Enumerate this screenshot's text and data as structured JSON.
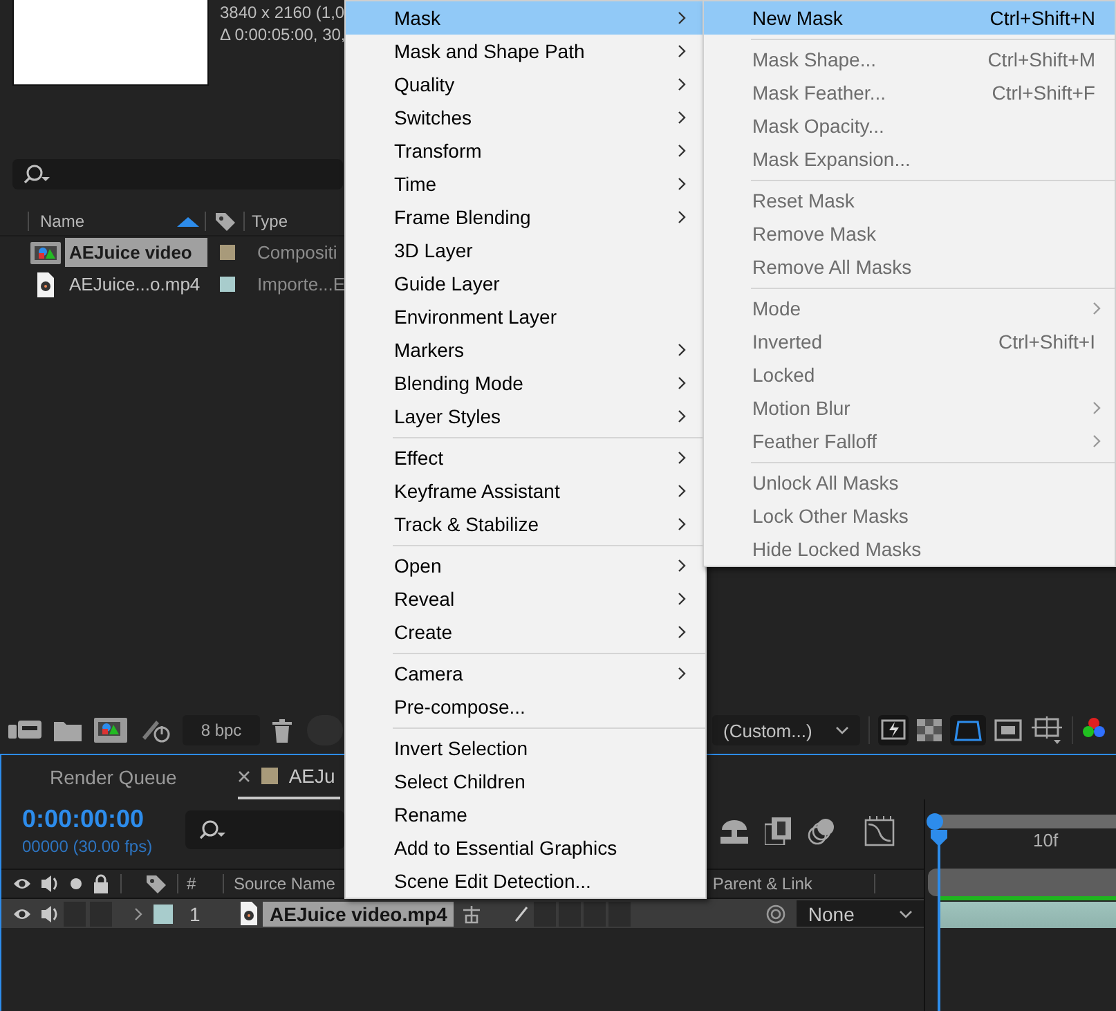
{
  "project": {
    "comp_info": [
      "3840 x 2160 (1,0",
      "Δ 0:00:05:00, 30,"
    ],
    "columns": [
      {
        "label": "Name",
        "sorted": true
      },
      {
        "label": "Type",
        "sorted": false
      }
    ],
    "items": [
      {
        "name": "AEJuice video",
        "kind": "composition",
        "color": "#a89a7a",
        "type": "Compositi",
        "selected": true
      },
      {
        "name": "AEJuice...o.mp4",
        "kind": "footage",
        "color": "#a8cccc",
        "type": "Importe...E",
        "selected": false
      }
    ]
  },
  "toolbar": {
    "bit_depth": "8 bpc",
    "view": "(Custom...)"
  },
  "timeline": {
    "tabs": [
      {
        "label": "Render Queue",
        "selected": false,
        "closable": false
      },
      {
        "label": "AEJu",
        "selected": true,
        "closable": true,
        "color": "#a89a7a"
      }
    ],
    "timecode": "0:00:00:00",
    "frame_info": "00000 (30.00 fps)",
    "columns": {
      "number": "#",
      "source_name": "Source Name",
      "parent": "Parent & Link"
    },
    "ruler": [
      "10f"
    ],
    "layers": [
      {
        "number": "1",
        "name": "AEJuice video.mp4",
        "color": "#a8cccc",
        "selected": true,
        "expanded": false,
        "parent": "None"
      }
    ]
  },
  "context_menu": {
    "groups": [
      [
        {
          "label": "Mask",
          "submenu": true,
          "selected": true,
          "disabled": false
        },
        {
          "label": "Mask and Shape Path",
          "submenu": true,
          "selected": false,
          "disabled": false
        },
        {
          "label": "Quality",
          "submenu": true,
          "selected": false,
          "disabled": false
        },
        {
          "label": "Switches",
          "submenu": true,
          "selected": false,
          "disabled": false
        },
        {
          "label": "Transform",
          "submenu": true,
          "selected": false,
          "disabled": false
        },
        {
          "label": "Time",
          "submenu": true,
          "selected": false,
          "disabled": false
        },
        {
          "label": "Frame Blending",
          "submenu": true,
          "selected": false,
          "disabled": false
        },
        {
          "label": "3D Layer",
          "submenu": false,
          "selected": false,
          "disabled": false
        },
        {
          "label": "Guide Layer",
          "submenu": false,
          "selected": false,
          "disabled": false
        },
        {
          "label": "Environment Layer",
          "submenu": false,
          "selected": false,
          "disabled": false
        },
        {
          "label": "Markers",
          "submenu": true,
          "selected": false,
          "disabled": false
        },
        {
          "label": "Blending Mode",
          "submenu": true,
          "selected": false,
          "disabled": false
        },
        {
          "label": "Layer Styles",
          "submenu": true,
          "selected": false,
          "disabled": false
        }
      ],
      [
        {
          "label": "Effect",
          "submenu": true,
          "selected": false,
          "disabled": false
        },
        {
          "label": "Keyframe Assistant",
          "submenu": true,
          "selected": false,
          "disabled": false
        },
        {
          "label": "Track & Stabilize",
          "submenu": true,
          "selected": false,
          "disabled": false
        }
      ],
      [
        {
          "label": "Open",
          "submenu": true,
          "selected": false,
          "disabled": false
        },
        {
          "label": "Reveal",
          "submenu": true,
          "selected": false,
          "disabled": false
        },
        {
          "label": "Create",
          "submenu": true,
          "selected": false,
          "disabled": false
        }
      ],
      [
        {
          "label": "Camera",
          "submenu": true,
          "selected": false,
          "disabled": false
        },
        {
          "label": "Pre-compose...",
          "submenu": false,
          "selected": false,
          "disabled": false
        }
      ],
      [
        {
          "label": "Invert Selection",
          "submenu": false,
          "selected": false,
          "disabled": false
        },
        {
          "label": "Select Children",
          "submenu": false,
          "selected": false,
          "disabled": false
        },
        {
          "label": "Rename",
          "submenu": false,
          "selected": false,
          "disabled": false
        },
        {
          "label": "Add to Essential Graphics",
          "submenu": false,
          "selected": false,
          "disabled": false
        },
        {
          "label": "Scene Edit Detection...",
          "submenu": false,
          "selected": false,
          "disabled": false
        }
      ]
    ]
  },
  "submenu": {
    "groups": [
      [
        {
          "label": "New Mask",
          "shortcut": "Ctrl+Shift+N",
          "submenu": false,
          "selected": true,
          "disabled": false
        }
      ],
      [
        {
          "label": "Mask Shape...",
          "shortcut": "Ctrl+Shift+M",
          "submenu": false,
          "selected": false,
          "disabled": true
        },
        {
          "label": "Mask Feather...",
          "shortcut": "Ctrl+Shift+F",
          "submenu": false,
          "selected": false,
          "disabled": true
        },
        {
          "label": "Mask Opacity...",
          "submenu": false,
          "selected": false,
          "disabled": true
        },
        {
          "label": "Mask Expansion...",
          "submenu": false,
          "selected": false,
          "disabled": true
        }
      ],
      [
        {
          "label": "Reset Mask",
          "submenu": false,
          "selected": false,
          "disabled": true
        },
        {
          "label": "Remove Mask",
          "submenu": false,
          "selected": false,
          "disabled": true
        },
        {
          "label": "Remove All Masks",
          "submenu": false,
          "selected": false,
          "disabled": true
        }
      ],
      [
        {
          "label": "Mode",
          "submenu": true,
          "selected": false,
          "disabled": true
        },
        {
          "label": "Inverted",
          "shortcut": "Ctrl+Shift+I",
          "submenu": false,
          "selected": false,
          "disabled": true
        },
        {
          "label": "Locked",
          "submenu": false,
          "selected": false,
          "disabled": true
        },
        {
          "label": "Motion Blur",
          "submenu": true,
          "selected": false,
          "disabled": true
        },
        {
          "label": "Feather Falloff",
          "submenu": true,
          "selected": false,
          "disabled": true
        }
      ],
      [
        {
          "label": "Unlock All Masks",
          "submenu": false,
          "selected": false,
          "disabled": true
        },
        {
          "label": "Lock Other Masks",
          "submenu": false,
          "selected": false,
          "disabled": true
        },
        {
          "label": "Hide Locked Masks",
          "submenu": false,
          "selected": false,
          "disabled": true
        }
      ]
    ]
  }
}
